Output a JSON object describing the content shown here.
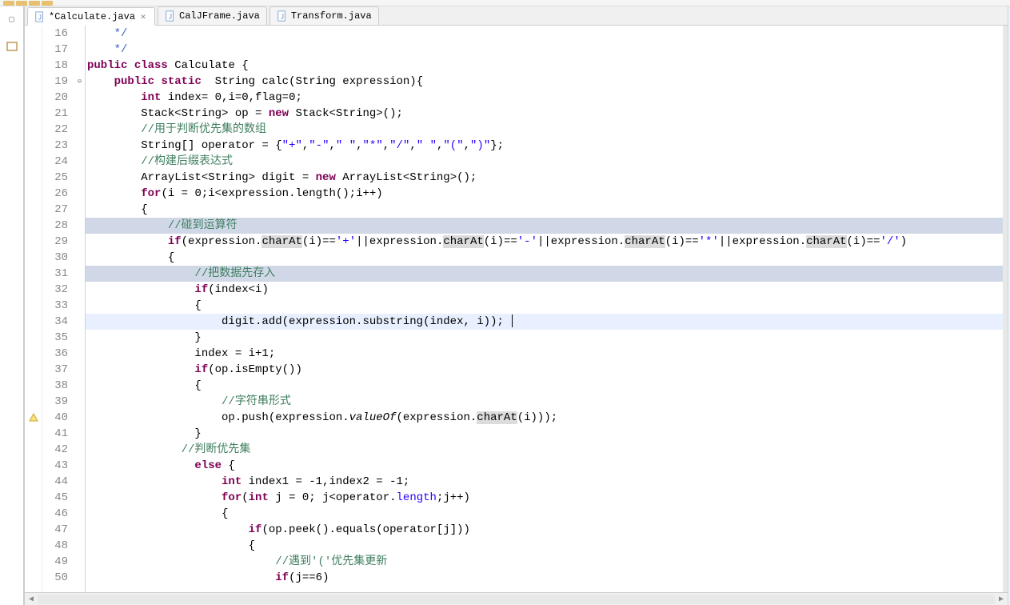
{
  "tabs": [
    {
      "label": "*Calculate.java",
      "active": true,
      "closeable": true
    },
    {
      "label": "CalJFrame.java",
      "active": false,
      "closeable": false
    },
    {
      "label": "Transform.java",
      "active": false,
      "closeable": false
    }
  ],
  "line_start": 16,
  "line_end": 50,
  "highlighted_lines": [
    28,
    31
  ],
  "current_line": 34,
  "fold_markers": {
    "19": "⊖"
  },
  "ruler_markers": {
    "40": "warn"
  },
  "code_lines": {
    "16": [
      {
        "cls": "cmd",
        "text": "    */"
      }
    ],
    "17": [
      {
        "cls": "kw",
        "text": "public"
      },
      {
        "cls": "id",
        "text": " "
      },
      {
        "cls": "kw",
        "text": "class"
      },
      {
        "cls": "id",
        "text": " Calculate {"
      }
    ],
    "18": [
      {
        "cls": "id",
        "text": "    "
      },
      {
        "cls": "kw",
        "text": "public"
      },
      {
        "cls": "id",
        "text": " "
      },
      {
        "cls": "kw",
        "text": "static"
      },
      {
        "cls": "id",
        "text": "  String calc(String expression){"
      }
    ],
    "19": [
      {
        "cls": "id",
        "text": "        "
      },
      {
        "cls": "kw",
        "text": "int"
      },
      {
        "cls": "id",
        "text": " index= 0,i=0,flag=0;"
      }
    ],
    "20": [
      {
        "cls": "id",
        "text": "        Stack<String> op = "
      },
      {
        "cls": "kw",
        "text": "new"
      },
      {
        "cls": "id",
        "text": " Stack<String>();"
      }
    ],
    "21": [
      {
        "cls": "id",
        "text": "        "
      },
      {
        "cls": "cm",
        "text": "//用于判断优先集的数组"
      }
    ],
    "22": [
      {
        "cls": "id",
        "text": "        String[] operator = {"
      },
      {
        "cls": "str",
        "text": "\"+\""
      },
      {
        "cls": "id",
        "text": ","
      },
      {
        "cls": "str",
        "text": "\"-\""
      },
      {
        "cls": "id",
        "text": ","
      },
      {
        "cls": "str",
        "text": "\" \""
      },
      {
        "cls": "id",
        "text": ","
      },
      {
        "cls": "str",
        "text": "\"*\""
      },
      {
        "cls": "id",
        "text": ","
      },
      {
        "cls": "str",
        "text": "\"/\""
      },
      {
        "cls": "id",
        "text": ","
      },
      {
        "cls": "str",
        "text": "\" \""
      },
      {
        "cls": "id",
        "text": ","
      },
      {
        "cls": "str",
        "text": "\"(\""
      },
      {
        "cls": "id",
        "text": ","
      },
      {
        "cls": "str",
        "text": "\")\""
      },
      {
        "cls": "id",
        "text": "};"
      }
    ],
    "23": [
      {
        "cls": "id",
        "text": "        "
      },
      {
        "cls": "cm",
        "text": "//构建后缀表达式"
      }
    ],
    "24": [
      {
        "cls": "id",
        "text": "        ArrayList<String> digit = "
      },
      {
        "cls": "kw",
        "text": "new"
      },
      {
        "cls": "id",
        "text": " ArrayList<String>();"
      }
    ],
    "25": [
      {
        "cls": "id",
        "text": "        "
      },
      {
        "cls": "kw",
        "text": "for"
      },
      {
        "cls": "id",
        "text": "(i = 0;i<expression.length();i++)"
      }
    ],
    "26": [
      {
        "cls": "id",
        "text": "        {"
      }
    ],
    "27": [
      {
        "cls": "id",
        "text": "            "
      },
      {
        "cls": "cm",
        "text": "//碰到运算符"
      }
    ],
    "28": [
      {
        "cls": "id",
        "text": "            "
      },
      {
        "cls": "kw",
        "text": "if"
      },
      {
        "cls": "id",
        "text": "(expression."
      },
      {
        "cls": "bghi",
        "text": "charAt"
      },
      {
        "cls": "id",
        "text": "(i)=="
      },
      {
        "cls": "str",
        "text": "'+'"
      },
      {
        "cls": "id",
        "text": "||expression."
      },
      {
        "cls": "bghi",
        "text": "charAt"
      },
      {
        "cls": "id",
        "text": "(i)=="
      },
      {
        "cls": "str",
        "text": "'-'"
      },
      {
        "cls": "id",
        "text": "||expression."
      },
      {
        "cls": "bghi",
        "text": "charAt"
      },
      {
        "cls": "id",
        "text": "(i)=="
      },
      {
        "cls": "str",
        "text": "'*'"
      },
      {
        "cls": "id",
        "text": "||expression."
      },
      {
        "cls": "bghi",
        "text": "charAt"
      },
      {
        "cls": "id",
        "text": "(i)=="
      },
      {
        "cls": "str",
        "text": "'/'"
      },
      {
        "cls": "id",
        "text": ")"
      }
    ],
    "29": [
      {
        "cls": "id",
        "text": "            {"
      }
    ],
    "30": [
      {
        "cls": "id",
        "text": "                "
      },
      {
        "cls": "cm",
        "text": "//把数据先存入"
      }
    ],
    "31": [
      {
        "cls": "id",
        "text": "                "
      },
      {
        "cls": "kw",
        "text": "if"
      },
      {
        "cls": "id",
        "text": "(index<i)"
      }
    ],
    "32": [
      {
        "cls": "id",
        "text": "                {"
      }
    ],
    "33": [
      {
        "cls": "id",
        "text": "                    digit.add(expression.substring(index, i)); "
      },
      {
        "cls": "caret",
        "text": ""
      }
    ],
    "34": [
      {
        "cls": "id",
        "text": "                }"
      }
    ],
    "35": [
      {
        "cls": "id",
        "text": "                index = i+1;"
      }
    ],
    "36": [
      {
        "cls": "id",
        "text": "                "
      },
      {
        "cls": "kw",
        "text": "if"
      },
      {
        "cls": "id",
        "text": "(op.isEmpty())"
      }
    ],
    "37": [
      {
        "cls": "id",
        "text": "                {"
      }
    ],
    "38": [
      {
        "cls": "id",
        "text": "                    "
      },
      {
        "cls": "cm",
        "text": "//字符串形式"
      }
    ],
    "39": [
      {
        "cls": "id",
        "text": "                    op.push(expression."
      },
      {
        "cls": "ital",
        "text": "valueOf"
      },
      {
        "cls": "id",
        "text": "(expression."
      },
      {
        "cls": "bghi",
        "text": "charAt"
      },
      {
        "cls": "id",
        "text": "(i)));"
      }
    ],
    "40": [
      {
        "cls": "id",
        "text": "                }"
      }
    ],
    "41": [
      {
        "cls": "id",
        "text": "              "
      },
      {
        "cls": "cm",
        "text": "//判断优先集"
      }
    ],
    "42": [
      {
        "cls": "id",
        "text": "                "
      },
      {
        "cls": "kw",
        "text": "else"
      },
      {
        "cls": "id",
        "text": " {"
      }
    ],
    "43": [
      {
        "cls": "id",
        "text": "                    "
      },
      {
        "cls": "kw",
        "text": "int"
      },
      {
        "cls": "id",
        "text": " index1 = -1,index2 = -1;"
      }
    ],
    "44": [
      {
        "cls": "id",
        "text": "                    "
      },
      {
        "cls": "kw",
        "text": "for"
      },
      {
        "cls": "id",
        "text": "("
      },
      {
        "cls": "kw",
        "text": "int"
      },
      {
        "cls": "id",
        "text": " j = 0; j<operator."
      },
      {
        "cls": "str",
        "text": "length"
      },
      {
        "cls": "id",
        "text": ";j++)"
      }
    ],
    "45": [
      {
        "cls": "id",
        "text": "                    {"
      }
    ],
    "46": [
      {
        "cls": "id",
        "text": "                        "
      },
      {
        "cls": "kw",
        "text": "if"
      },
      {
        "cls": "id",
        "text": "(op.peek().equals(operator[j]))"
      }
    ],
    "47": [
      {
        "cls": "id",
        "text": "                        {"
      }
    ],
    "48": [
      {
        "cls": "id",
        "text": "                            "
      },
      {
        "cls": "cm",
        "text": "//遇到'('优先集更新"
      }
    ],
    "49": [
      {
        "cls": "id",
        "text": "                            "
      },
      {
        "cls": "kw",
        "text": "if"
      },
      {
        "cls": "id",
        "text": "(j==6)"
      }
    ]
  },
  "line_number_map": {
    "16": "16",
    "17": "17",
    "18": "18",
    "19": "19",
    "20": "20",
    "21": "21",
    "22": "22",
    "23": "23",
    "24": "24",
    "25": "25",
    "26": "26",
    "27": "27",
    "28": "28",
    "29": "29",
    "30": "30",
    "31": "31",
    "32": "32",
    "33": "33",
    "34": "34",
    "35": "35",
    "36": "36",
    "37": "37",
    "38": "38",
    "39": "39",
    "40": "40",
    "41": "41",
    "42": "42",
    "43": "43",
    "44": "44",
    "45": "45",
    "46": "46",
    "47": "47",
    "48": "48",
    "49": "49",
    "50": "50"
  },
  "display_line_offset": 1
}
